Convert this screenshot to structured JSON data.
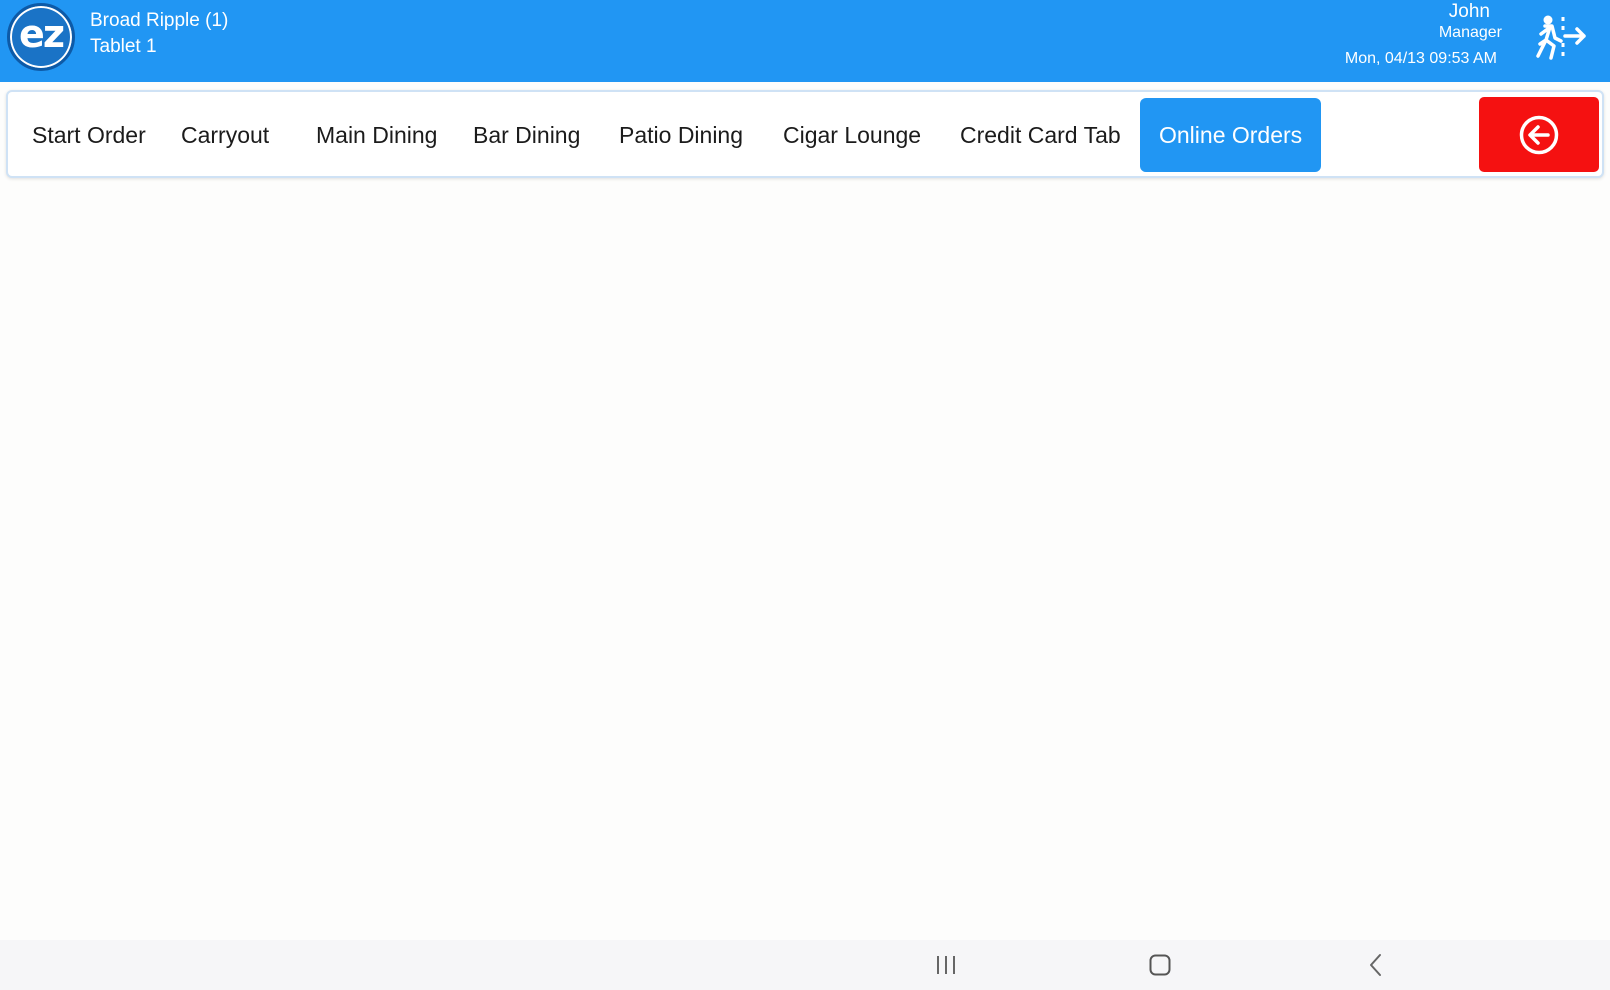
{
  "header": {
    "logo_text": "ez",
    "store_name": "Broad Ripple (1)",
    "device_name": "Tablet 1",
    "user_name": "John",
    "user_role": "Manager",
    "datetime": "Mon, 04/13 09:53 AM",
    "exit_icon": "person-exit-icon"
  },
  "nav": {
    "tabs": [
      {
        "label": "Start Order",
        "active": false
      },
      {
        "label": "Carryout",
        "active": false
      },
      {
        "label": "Main Dining",
        "active": false
      },
      {
        "label": "Bar Dining",
        "active": false
      },
      {
        "label": "Patio Dining",
        "active": false
      },
      {
        "label": "Cigar Lounge",
        "active": false
      },
      {
        "label": "Credit Card Tab",
        "active": false
      },
      {
        "label": "Online Orders",
        "active": true
      }
    ],
    "back_icon": "circle-arrow-left-icon"
  },
  "system_bar": {
    "icons": [
      "recent-apps-icon",
      "home-icon",
      "back-icon"
    ]
  },
  "colors": {
    "header_bg": "#2196f3",
    "active_tab": "#2196f3",
    "back_button": "#f51111",
    "page_bg": "#fdfdfc"
  }
}
